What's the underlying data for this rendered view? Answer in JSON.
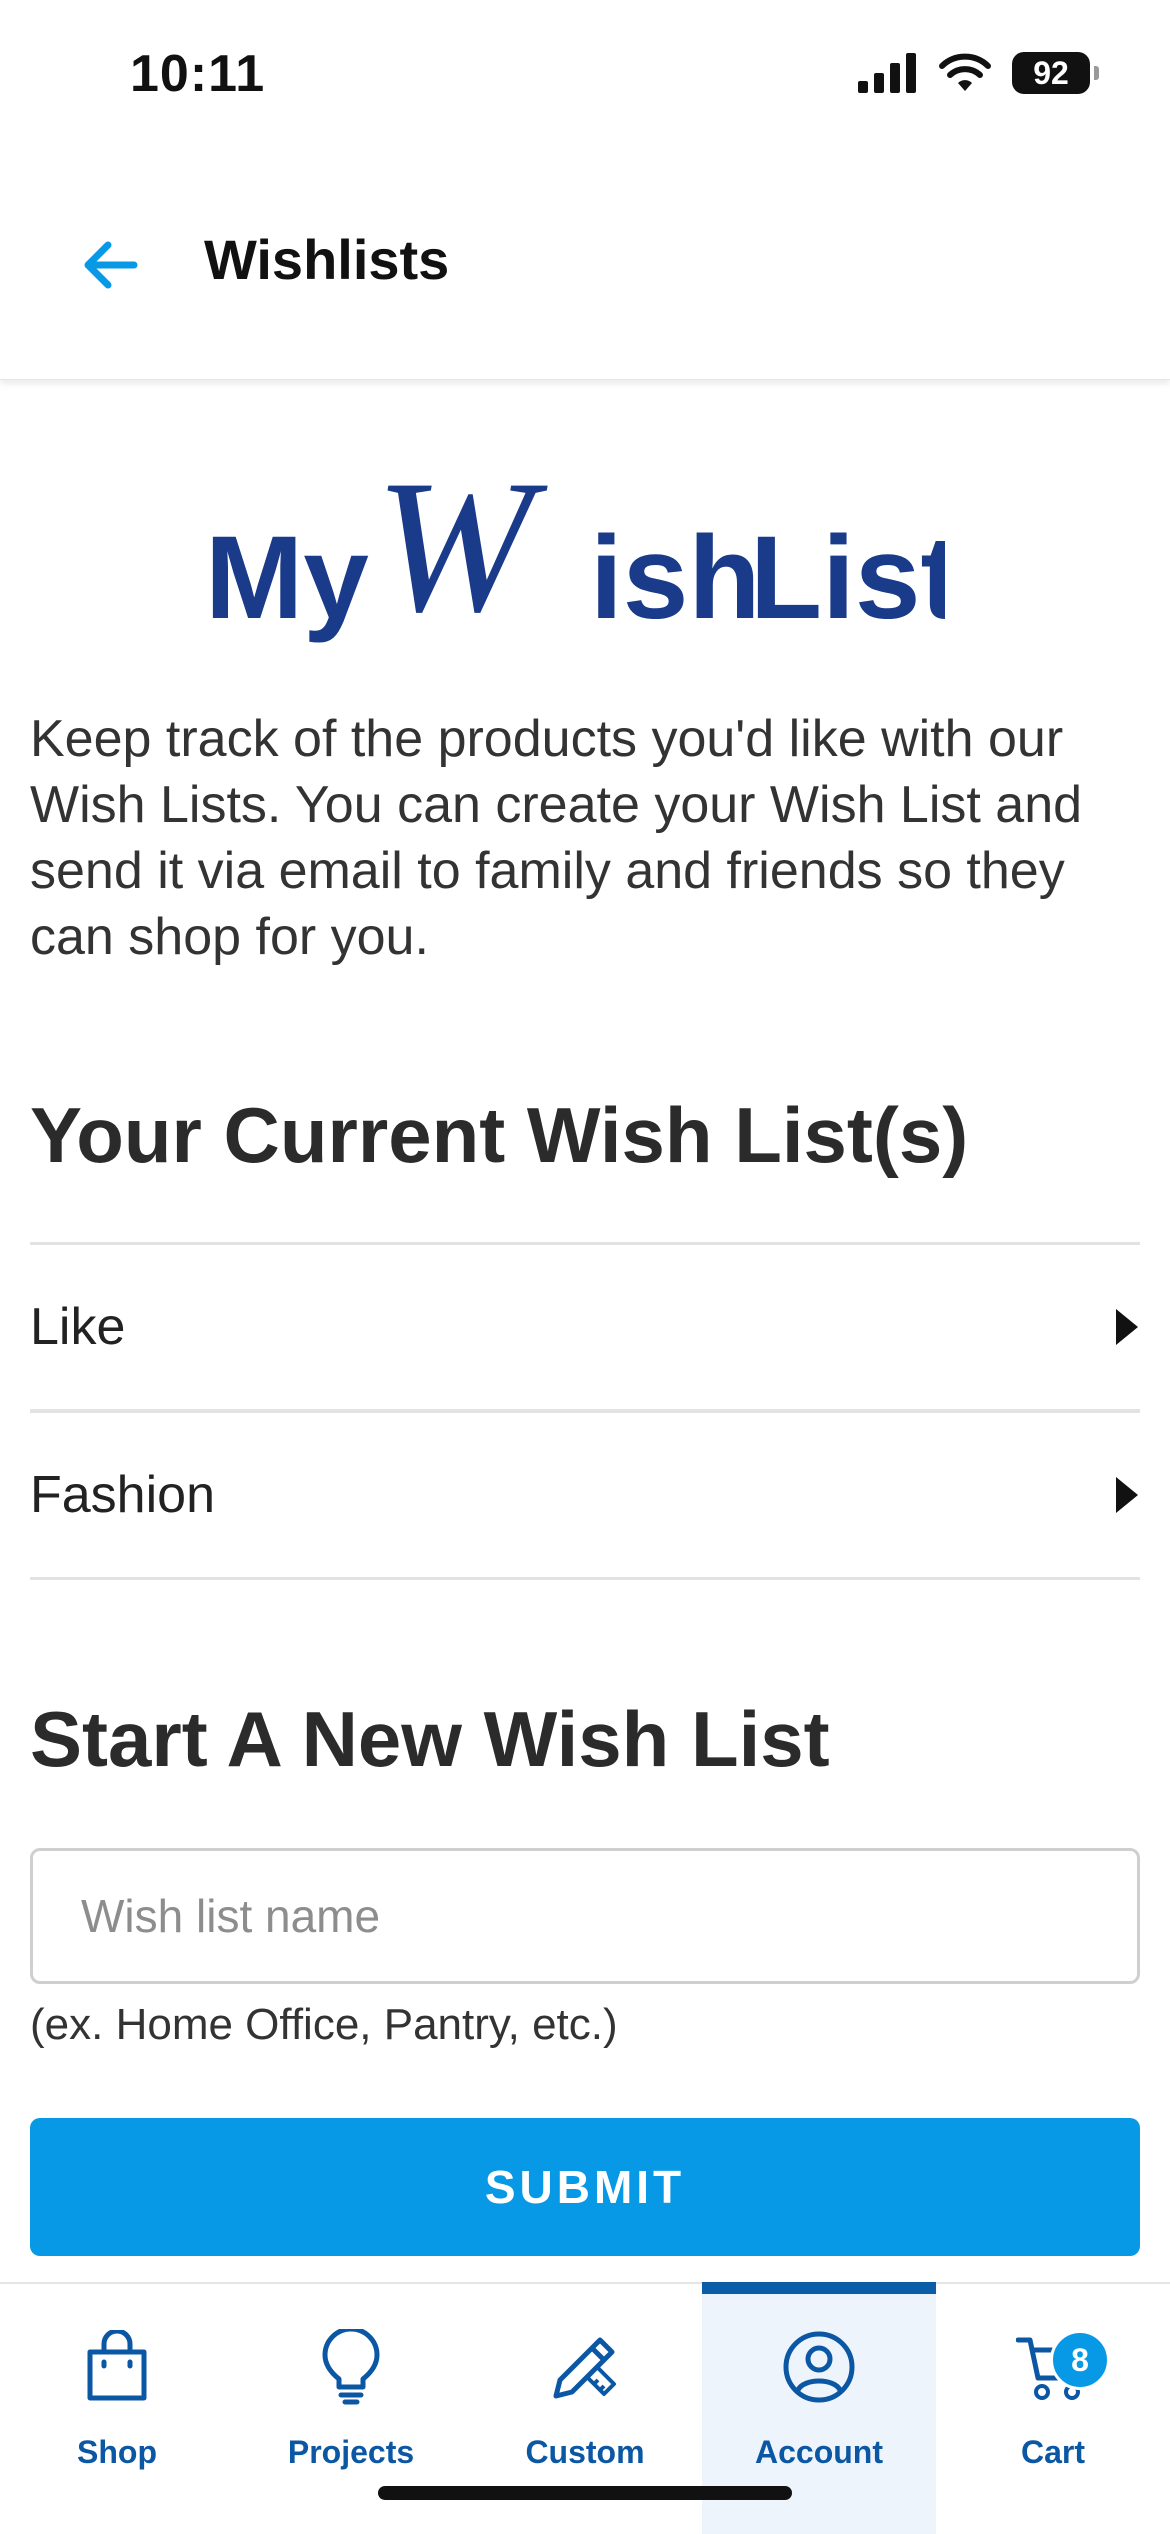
{
  "status": {
    "time": "10:11",
    "battery": "92"
  },
  "header": {
    "title": "Wishlists"
  },
  "logo": {
    "text_my": "My",
    "text_w": "W",
    "text_ish": "ish",
    "text_list": "List"
  },
  "intro": "Keep track of the products you'd like with our Wish Lists. You can create your Wish List and send it via email to family and friends so they can shop for you.",
  "current": {
    "title": "Your Current Wish List(s)",
    "lists": [
      {
        "label": "Like"
      },
      {
        "label": "Fashion"
      }
    ]
  },
  "new_list": {
    "title": "Start A New Wish List",
    "input_placeholder": "Wish list name",
    "input_value": "",
    "hint": "(ex. Home Office, Pantry, etc.)",
    "submit_label": "SUBMIT"
  },
  "tabbar": {
    "active": "Account",
    "tabs": [
      {
        "label": "Shop",
        "icon": "shopping-bag-icon"
      },
      {
        "label": "Projects",
        "icon": "lightbulb-icon"
      },
      {
        "label": "Custom",
        "icon": "pencil-ruler-icon"
      },
      {
        "label": "Account",
        "icon": "user-circle-icon"
      },
      {
        "label": "Cart",
        "icon": "cart-icon",
        "badge": "8"
      }
    ]
  },
  "colors": {
    "accent": "#0799e6",
    "nav_blue": "#0b57a4",
    "logo_blue": "#1a3a8a"
  }
}
